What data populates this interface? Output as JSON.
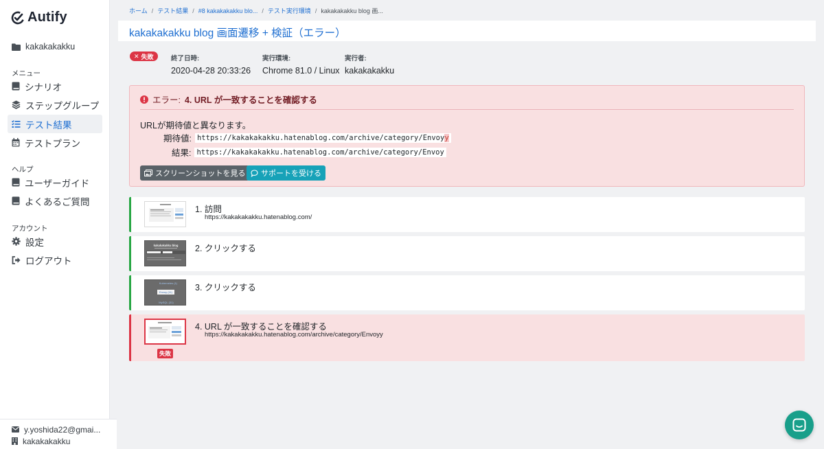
{
  "app": {
    "logo_text": "Autify"
  },
  "sidebar": {
    "project": "kakakakakku",
    "sections": [
      {
        "label": "メニュー",
        "items": [
          {
            "label": "シナリオ",
            "icon": "book-icon"
          },
          {
            "label": "ステップグループ",
            "icon": "layers-icon"
          },
          {
            "label": "テスト結果",
            "icon": "list-check-icon",
            "active": true
          },
          {
            "label": "テストプラン",
            "icon": "calendar-icon"
          }
        ]
      },
      {
        "label": "ヘルプ",
        "items": [
          {
            "label": "ユーザーガイド",
            "icon": "book-icon"
          },
          {
            "label": "よくあるご質問",
            "icon": "book-icon"
          }
        ]
      },
      {
        "label": "アカウント",
        "items": [
          {
            "label": "設定",
            "icon": "gear-icon"
          },
          {
            "label": "ログアウト",
            "icon": "sign-out-icon"
          }
        ]
      }
    ],
    "user": {
      "email": "y.yoshida22@gmai...",
      "org": "kakakakakku"
    }
  },
  "breadcrumb": [
    "ホーム",
    "テスト結果",
    "#8 kakakakakku blo...",
    "テスト実行環境",
    "kakakakakku blog 画..."
  ],
  "page_title": "kakakakakku blog 画面遷移 + 検証（エラー）",
  "result": {
    "status_badge": "失敗",
    "meta": [
      {
        "key": "終了日時:",
        "value": "2020-04-28 20:33:26"
      },
      {
        "key": "実行環境:",
        "value": "Chrome 81.0 / Linux"
      },
      {
        "key": "実行者:",
        "value": "kakakakakku"
      }
    ]
  },
  "error": {
    "prefix": "エラー:",
    "step_name": "4. URL が一致することを確認する",
    "message": "URLが期待値と異なります。",
    "expected_label": "期待値:",
    "expected_value_main": "https://kakakakakku.hatenablog.com/archive/category/Envoy",
    "expected_value_diff": "y",
    "actual_label": "結果:",
    "actual_value": "https://kakakakakku.hatenablog.com/archive/category/Envoy",
    "screenshot_button": "スクリーンショットを見る",
    "support_button": "サポートを受ける"
  },
  "steps": [
    {
      "label": "1. 訪問",
      "url": "https://kakakakakku.hatenablog.com/",
      "status": "success"
    },
    {
      "label": "2. クリックする",
      "url": "",
      "status": "success"
    },
    {
      "label": "3. クリックする",
      "url": "",
      "status": "success"
    },
    {
      "label": "4. URL が一致することを確認する",
      "url": "https://kakakakakku.hatenablog.com/archive/category/Envoyy",
      "status": "failed",
      "fail_tag": "失敗"
    }
  ],
  "thumbnails": {
    "step2_title": "kakakakakku blog",
    "step3_items": [
      "Kubernetes (1)",
      "Envoy (11)",
      "MySQL (31)"
    ]
  },
  "colors": {
    "accent": "#1f6fd1",
    "danger": "#dc3545",
    "success": "#28a745",
    "info": "#17a2b8"
  }
}
